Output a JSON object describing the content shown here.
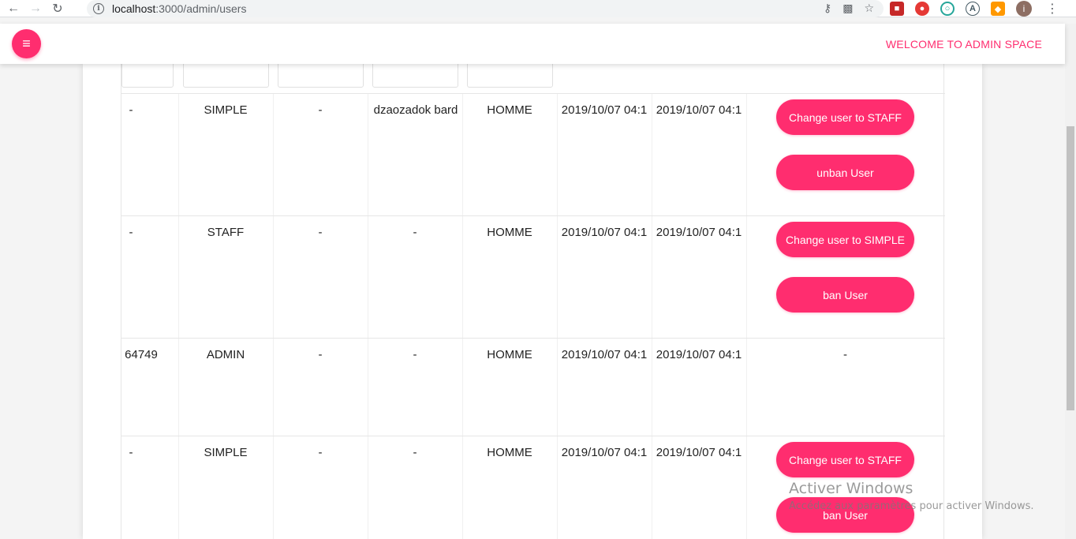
{
  "browser": {
    "url_host": "localhost",
    "url_path": ":3000/admin/users",
    "avatar_initial": "i"
  },
  "header": {
    "welcome_text": "WELCOME TO ADMIN SPACE",
    "accent_color": "#ff2d6f"
  },
  "rows": [
    {
      "c1": "-",
      "role": "SIMPLE",
      "c3": "-",
      "c4": "dzaozadok bard",
      "gender": "HOMME",
      "created": "2019/10/07 04:1",
      "updated": "2019/10/07 04:1",
      "action1": "Change user to STAFF",
      "action2": "unban User"
    },
    {
      "c1": "-",
      "role": "STAFF",
      "c3": "-",
      "c4": "-",
      "gender": "HOMME",
      "created": "2019/10/07 04:1",
      "updated": "2019/10/07 04:1",
      "action1": "Change user to SIMPLE",
      "action2": "ban User"
    },
    {
      "c1": "64749",
      "role": "ADMIN",
      "c3": "-",
      "c4": "-",
      "gender": "HOMME",
      "created": "2019/10/07 04:1",
      "updated": "2019/10/07 04:1",
      "action_placeholder": "-"
    },
    {
      "c1": "-",
      "role": "SIMPLE",
      "c3": "-",
      "c4": "-",
      "gender": "HOMME",
      "created": "2019/10/07 04:1",
      "updated": "2019/10/07 04:1",
      "action1": "Change user to STAFF",
      "action2": "ban User"
    }
  ],
  "watermark": {
    "title": "Activer Windows",
    "subtitle": "Accédez aux paramètres pour activer Windows."
  }
}
